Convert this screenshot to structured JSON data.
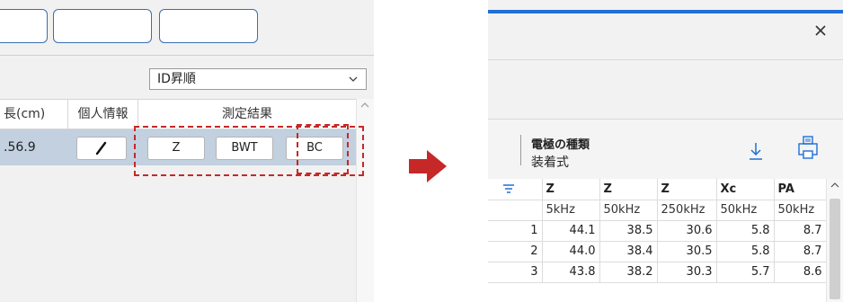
{
  "left": {
    "sort_select": {
      "value": "ID昇順"
    },
    "headers": {
      "height": "長(cm)",
      "personal": "個人情報",
      "result": "測定結果"
    },
    "row": {
      "height": ".56.9"
    },
    "buttons": {
      "z": "Z",
      "bwt": "BWT",
      "bc": "BC"
    }
  },
  "right": {
    "electrode_label": "電極の種類",
    "electrode_value": "装着式",
    "table": {
      "headers": [
        "Z",
        "Z",
        "Z",
        "Xc",
        "PA"
      ],
      "units": [
        "5kHz",
        "50kHz",
        "250kHz",
        "50kHz",
        "50kHz"
      ],
      "rows": [
        {
          "index": "1",
          "values": [
            "44.1",
            "38.5",
            "30.6",
            "5.8",
            "8.7"
          ]
        },
        {
          "index": "2",
          "values": [
            "44.0",
            "38.4",
            "30.5",
            "5.8",
            "8.7"
          ]
        },
        {
          "index": "3",
          "values": [
            "43.8",
            "38.2",
            "30.3",
            "5.7",
            "8.6"
          ]
        }
      ]
    }
  },
  "colors": {
    "accent_blue": "#1e6fd8",
    "highlight_red": "#c62828",
    "selected_row": "#c2d0e0"
  },
  "icons": [
    "chevron-down-icon",
    "pencil-icon",
    "close-icon",
    "download-icon",
    "print-icon",
    "filter-icon",
    "arrow-right-icon"
  ]
}
